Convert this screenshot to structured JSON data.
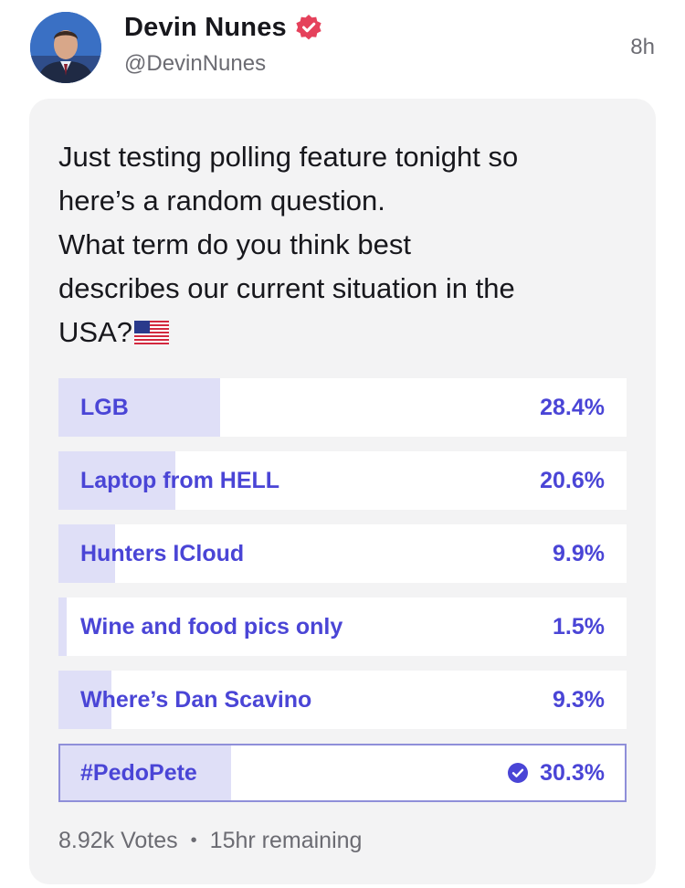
{
  "author": {
    "name": "Devin Nunes",
    "handle": "@DevinNunes",
    "timestamp": "8h",
    "verified_badge_color": "#e5415b"
  },
  "post": {
    "text": "Just testing polling feature tonight so\nhere’s a random question.\nWhat term do you think best\ndescribes our current situation in the\nUSA?"
  },
  "poll": {
    "accent_color": "#4a45d6",
    "fill_color": "#dfdff7",
    "options": [
      {
        "label": "LGB",
        "percent": "28.4%",
        "value": 28.4,
        "selected": false
      },
      {
        "label": "Laptop from HELL",
        "percent": "20.6%",
        "value": 20.6,
        "selected": false
      },
      {
        "label": "Hunters ICloud",
        "percent": "9.9%",
        "value": 9.9,
        "selected": false
      },
      {
        "label": "Wine and food pics only",
        "percent": "1.5%",
        "value": 1.5,
        "selected": false
      },
      {
        "label": "Where’s Dan Scavino",
        "percent": "9.3%",
        "value": 9.3,
        "selected": false
      },
      {
        "label": "#PedoPete",
        "percent": "30.3%",
        "value": 30.3,
        "selected": true
      }
    ],
    "votes": "8.92k Votes",
    "separator": "•",
    "remaining": "15hr remaining"
  }
}
